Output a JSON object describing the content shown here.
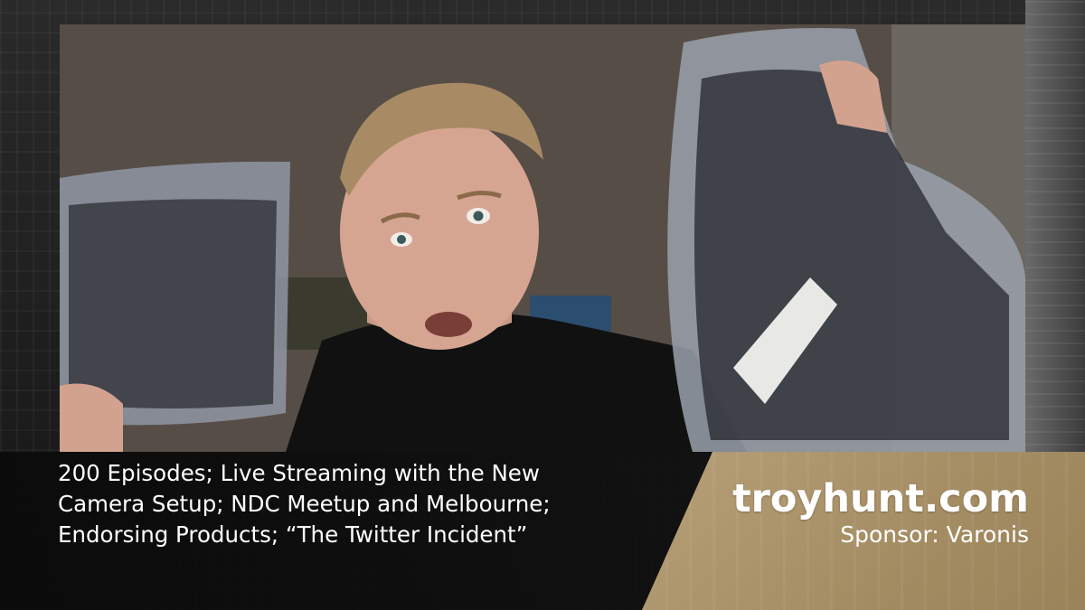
{
  "episode": {
    "title": "200 Episodes; Live Streaming with the New\nCamera Setup; NDC Meetup and Melbourne;\nEndorsing Products; “The Twitter Incident”"
  },
  "brand": {
    "site": "troyhunt.com",
    "sponsor": "Sponsor: Varonis"
  },
  "colors": {
    "brand_panel": "#a48c63",
    "caption_bg": "#141414",
    "text": "#ffffff"
  }
}
